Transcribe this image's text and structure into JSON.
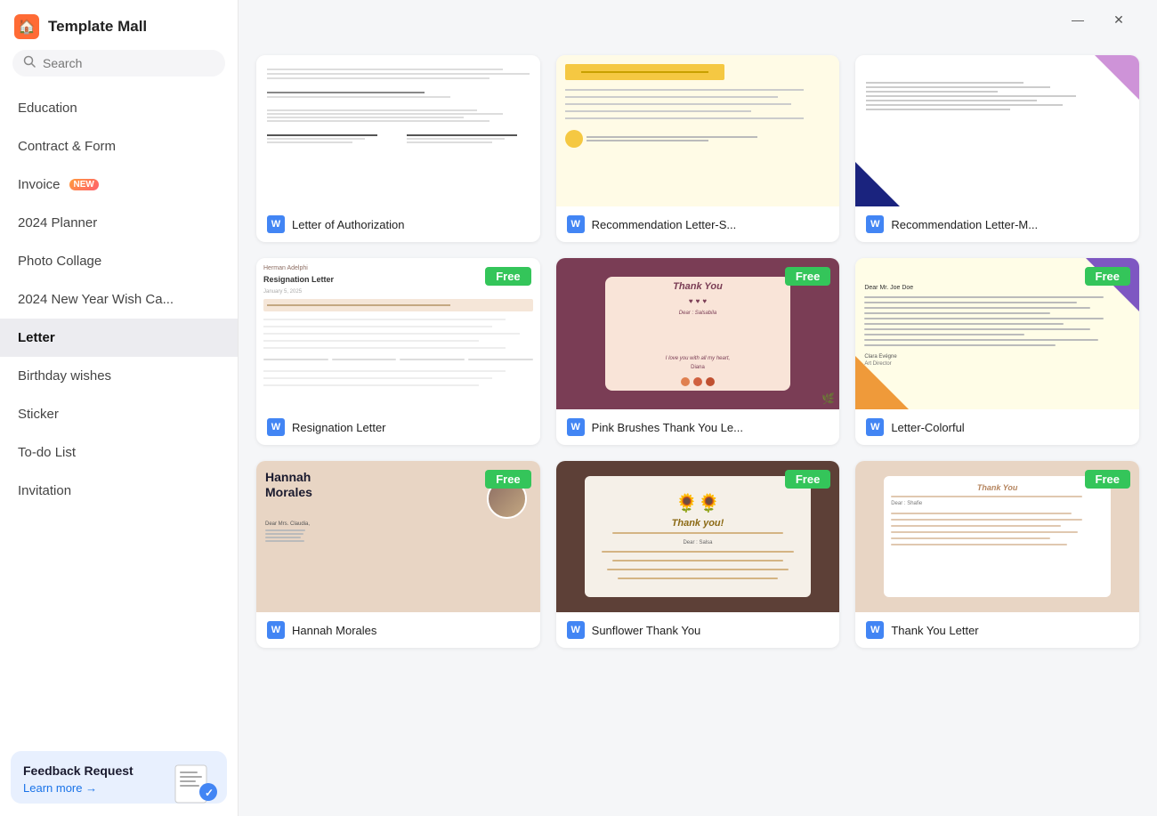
{
  "app": {
    "title": "Template Mall",
    "logo": "🏠"
  },
  "search": {
    "placeholder": "Search"
  },
  "nav": {
    "items": [
      {
        "id": "education",
        "label": "Education",
        "active": false,
        "badge": null
      },
      {
        "id": "contract-form",
        "label": "Contract & Form",
        "active": false,
        "badge": null
      },
      {
        "id": "invoice",
        "label": "Invoice",
        "active": false,
        "badge": "NEW"
      },
      {
        "id": "2024-planner",
        "label": "2024 Planner",
        "active": false,
        "badge": null
      },
      {
        "id": "photo-collage",
        "label": "Photo Collage",
        "active": false,
        "badge": null
      },
      {
        "id": "2024-new-year",
        "label": "2024 New Year Wish Ca...",
        "active": false,
        "badge": null
      },
      {
        "id": "letter",
        "label": "Letter",
        "active": true,
        "badge": null
      },
      {
        "id": "birthday-wishes",
        "label": "Birthday wishes",
        "active": false,
        "badge": null
      },
      {
        "id": "sticker",
        "label": "Sticker",
        "active": false,
        "badge": null
      },
      {
        "id": "to-do-list",
        "label": "To-do List",
        "active": false,
        "badge": null
      },
      {
        "id": "invitation",
        "label": "Invitation",
        "active": false,
        "badge": null
      }
    ]
  },
  "feedback": {
    "title": "Feedback Request",
    "link_text": "Learn more →"
  },
  "window": {
    "minimize": "—",
    "close": "✕"
  },
  "templates": {
    "rows": [
      [
        {
          "id": "letter-auth",
          "name": "Letter of Authorization",
          "free": false,
          "preview_type": "letter_auth"
        },
        {
          "id": "rec-letter-s",
          "name": "Recommendation Letter-S...",
          "free": false,
          "preview_type": "rec1"
        },
        {
          "id": "rec-letter-m",
          "name": "Recommendation Letter-M...",
          "free": false,
          "preview_type": "rec2"
        }
      ],
      [
        {
          "id": "resignation",
          "name": "Resignation Letter",
          "free": true,
          "preview_type": "resignation"
        },
        {
          "id": "pink-thankyou",
          "name": "Pink Brushes Thank You Le...",
          "free": true,
          "preview_type": "pink_ty"
        },
        {
          "id": "letter-colorful",
          "name": "Letter-Colorful",
          "free": true,
          "preview_type": "colorful"
        }
      ],
      [
        {
          "id": "hannah",
          "name": "Hannah Morales",
          "free": true,
          "preview_type": "hannah"
        },
        {
          "id": "sunflower-ty",
          "name": "Sunflower Thank You",
          "free": true,
          "preview_type": "sunflower"
        },
        {
          "id": "ty3",
          "name": "Thank You Letter",
          "free": true,
          "preview_type": "ty3"
        }
      ]
    ]
  }
}
